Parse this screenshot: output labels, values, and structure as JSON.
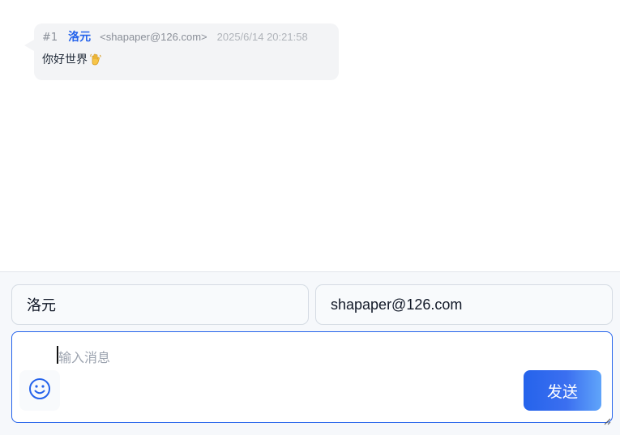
{
  "thread": {
    "messages": [
      {
        "index": "#1",
        "author": "洛元",
        "email": "<shapaper@126.com>",
        "time": "2025/6/14 20:21:58",
        "text": "你好世界",
        "emoji": "waving-hand"
      }
    ]
  },
  "compose": {
    "name_value": "洛元",
    "email_value": "shapaper@126.com",
    "message_placeholder": "输入消息",
    "emoji_icon": "smiley-icon",
    "send_label": "发送"
  },
  "colors": {
    "accent": "#2563eb",
    "bubble_bg": "#f3f4f6",
    "compose_bg": "#f6f8fb"
  }
}
